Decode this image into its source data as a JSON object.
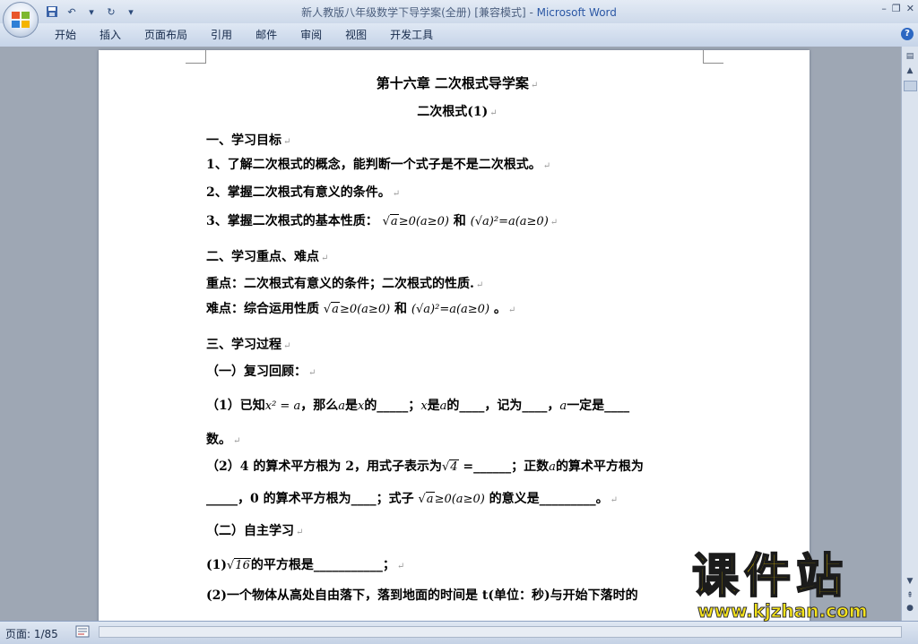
{
  "window": {
    "title": "新人教版八年级数学下导学案(全册) [兼容模式]",
    "app_name": "Microsoft Word",
    "separator": " - "
  },
  "ribbon": {
    "tabs": [
      "开始",
      "插入",
      "页面布局",
      "引用",
      "邮件",
      "审阅",
      "视图",
      "开发工具"
    ]
  },
  "document": {
    "chapter_title": "第十六章  二次根式导学案",
    "section_title": "二次根式(1)",
    "h1": "一、学习目标",
    "goal1": "1、了解二次根式的概念，能判断一个式子是不是二次根式。",
    "goal2": "2、掌握二次根式有意义的条件。",
    "goal3_prefix": "3、掌握二次根式的基本性质：",
    "prop1": "≥0(a≥0)",
    "and": "和",
    "prop2": "=a(a≥0)",
    "h2": "二、学习重点、难点",
    "key_point": "重点：二次根式有意义的条件；二次根式的性质.",
    "difficulty_prefix": "难点：综合运用性质",
    "period": "。",
    "h3": "三、学习过程",
    "sub1": "（一）复习回顾：",
    "q1_a": "（1）已知",
    "q1_b": "，那么",
    "q1_c": "是",
    "q1_d": "的_____；",
    "q1_e": "是",
    "q1_f": "的____，记为____，",
    "q1_g": "一定是____",
    "q1_end": "数。",
    "q2_a": "（2）4 的算术平方根为 2，用式子表示为",
    "q2_b": " =______；正数",
    "q2_c": "的算术平方根为",
    "q2_line2a": "_____，0 的算术平方根为____；式子",
    "q2_line2b": "的意义是_________。",
    "sub2": "（二）自主学习",
    "s1_a": "(1)",
    "s1_b": "的平方根是___________；",
    "s2": "(2)一个物体从高处自由落下，落到地面的时间是 t(单位：秒)与开始下落时的",
    "var_a": "a",
    "var_x": "x",
    "num_4": "4",
    "num_16": "16",
    "x_squared_eq": "x² = a",
    "sqrt_a_sq": "(√a)²"
  },
  "status": {
    "page": "页面: 1/85"
  },
  "watermark": {
    "main": "课件站",
    "url": "www.kjzhan.com"
  }
}
